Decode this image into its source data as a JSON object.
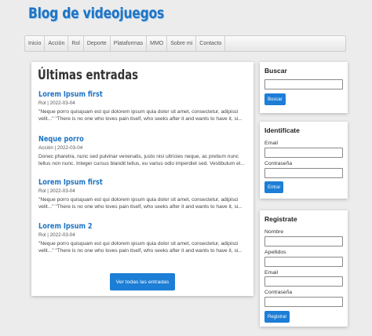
{
  "header": {
    "title": "Blog de videojuegos"
  },
  "nav": {
    "items": [
      "Inicio",
      "Acción",
      "Rol",
      "Deporte",
      "Plataformas",
      "MMO",
      "Sobre mi",
      "Contacto"
    ]
  },
  "main": {
    "heading": "Últimas entradas",
    "posts": [
      {
        "title": "Lorem Ipsum first",
        "meta": "Rol | 2022-03-04",
        "excerpt": "\"Neque porro quisquam est qui dolorem ipsum quia dolor sit amet, consectetur, adipisci velit...\" \"There is no one who loves pain itself, who seeks after it and wants to have it, si..."
      },
      {
        "title": "Neque porro",
        "meta": "Acción | 2022-03-04",
        "excerpt": "Donec pharetra, nunc sed pulvinar venenatis, justo nisi ultricies neque, ac pretium nunc tellus non nunc. Integer cursus blandit tellus, eu varius odio imperdiet sed. Vestibulum el..."
      },
      {
        "title": "Lorem Ipsum first",
        "meta": "Rol | 2022-03-04",
        "excerpt": "\"Neque porro quisquam est qui dolorem ipsum quia dolor sit amet, consectetur, adipisci velit...\" \"There is no one who loves pain itself, who seeks after it and wants to have it, si..."
      },
      {
        "title": "Lorem Ipsum 2",
        "meta": "Rol | 2022-03-04",
        "excerpt": "\"Neque porro quisquam est qui dolorem ipsum quia dolor sit amet, consectetur, adipisci velit...\" \"There is no one who loves pain itself, who seeks after it and wants to have it, si..."
      }
    ],
    "view_all_label": "Ver todas las entradas"
  },
  "search": {
    "title": "Buscar",
    "value": "",
    "button_label": "Buscar"
  },
  "login": {
    "title": "Identifícate",
    "email_label": "Email",
    "email_value": "",
    "password_label": "Contraseña",
    "password_value": "",
    "button_label": "Entrar"
  },
  "register": {
    "title": "Registrate",
    "name_label": "Nombre",
    "name_value": "",
    "surname_label": "Apellidos",
    "surname_value": "",
    "email_label": "Email",
    "email_value": "",
    "password_label": "Contraseña",
    "password_value": "",
    "button_label": "Registrar"
  },
  "colors": {
    "accent": "#1c7ed6",
    "title": "#1f74c4",
    "background": "#ececec"
  }
}
